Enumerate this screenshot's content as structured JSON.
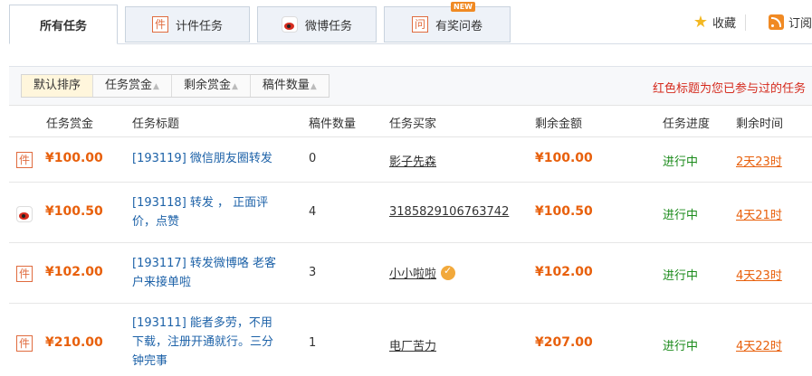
{
  "tabs": [
    {
      "label": "所有任务",
      "icon": ""
    },
    {
      "label": "计件任务",
      "icon": "jian-icon",
      "glyph": "件"
    },
    {
      "label": "微博任务",
      "icon": "weibo-icon"
    },
    {
      "label": "有奖问卷",
      "icon": "wen-icon",
      "glyph": "问",
      "badge": "NEW"
    }
  ],
  "top_links": {
    "favorite": "收藏",
    "subscribe": "订阅"
  },
  "sort": {
    "buttons": [
      "默认排序",
      "任务赏金",
      "剩余赏金",
      "稿件数量"
    ],
    "note": "红色标题为您已参与过的任务"
  },
  "columns": [
    "任务赏金",
    "任务标题",
    "稿件数量",
    "任务买家",
    "剩余金额",
    "任务进度",
    "剩余时间"
  ],
  "rows": [
    {
      "type_glyph": "件",
      "type": "jian-icon",
      "reward": "¥100.00",
      "title_lines": [
        "[193119] 微信朋友圈转发"
      ],
      "count": "0",
      "buyer": "影子先森",
      "remaining": "¥100.00",
      "status": "进行中",
      "time_left": "2天23时"
    },
    {
      "type_glyph": "",
      "type": "weibo-icon",
      "reward": "¥100.50",
      "title_lines": [
        "[193118] 转发 ， 正面评",
        "价，点赞"
      ],
      "count": "4",
      "buyer": "3185829106763742",
      "remaining": "¥100.50",
      "status": "进行中",
      "time_left": "4天21时"
    },
    {
      "type_glyph": "件",
      "type": "jian-icon",
      "reward": "¥102.00",
      "title_lines": [
        "[193117] 转发微博咯 老客",
        "户来接单啦"
      ],
      "count": "3",
      "buyer": "小小啦啦",
      "verified": true,
      "remaining": "¥102.00",
      "status": "进行中",
      "time_left": "4天23时"
    },
    {
      "type_glyph": "件",
      "type": "jian-icon",
      "reward": "¥210.00",
      "title_lines": [
        "[193111] 能者多劳，不用",
        "下载，注册开通就行。三分",
        "钟完事"
      ],
      "count": "1",
      "buyer": "电厂苦力",
      "remaining": "¥207.00",
      "status": "进行中",
      "time_left": "4天22时"
    }
  ]
}
